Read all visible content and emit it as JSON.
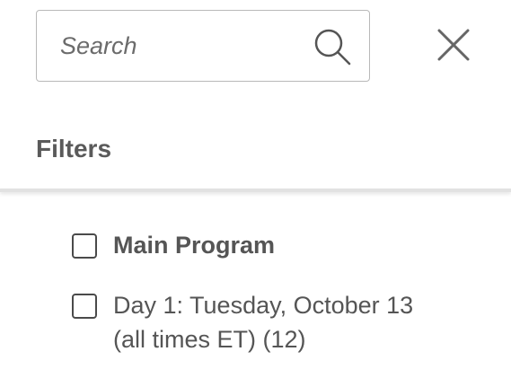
{
  "search": {
    "placeholder": "Search",
    "value": ""
  },
  "icons": {
    "search": "search-icon",
    "close": "close-icon",
    "checkbox": "checkbox-unchecked"
  },
  "filters": {
    "title": "Filters",
    "items": [
      {
        "label": "Main Program",
        "checked": false
      },
      {
        "label": "Day 1: Tuesday, October 13 (all times ET) (12)",
        "checked": false
      }
    ]
  },
  "colors": {
    "text": "#555555",
    "border": "#b9b9b9",
    "checkbox_border": "#4a4a4a",
    "divider": "#e2e2e2",
    "background": "#ffffff"
  }
}
